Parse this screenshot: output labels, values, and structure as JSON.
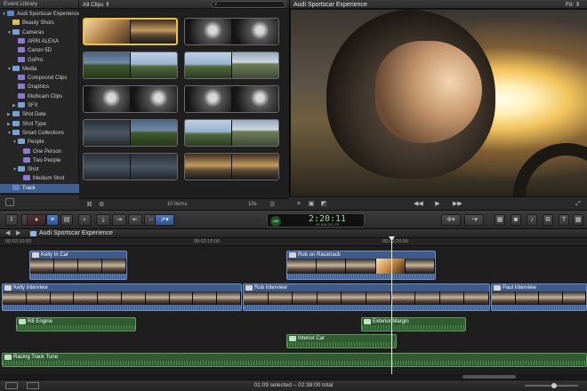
{
  "library": {
    "title": "Event Library",
    "items": [
      {
        "label": "Audi Sportscar Experience",
        "indent": 0,
        "tri": "▼",
        "icon": "event",
        "selected": false
      },
      {
        "label": "Beauty Shots",
        "indent": 1,
        "tri": "",
        "icon": "star",
        "selected": false
      },
      {
        "label": "Cameras",
        "indent": 1,
        "tri": "▼",
        "icon": "folder",
        "selected": false
      },
      {
        "label": "ARRI ALEXA",
        "indent": 2,
        "tri": "",
        "icon": "smart",
        "selected": false
      },
      {
        "label": "Canon 5D",
        "indent": 2,
        "tri": "",
        "icon": "smart",
        "selected": false
      },
      {
        "label": "GoPro",
        "indent": 2,
        "tri": "",
        "icon": "smart",
        "selected": false
      },
      {
        "label": "Media",
        "indent": 1,
        "tri": "▼",
        "icon": "folder",
        "selected": false
      },
      {
        "label": "Compound Clips",
        "indent": 2,
        "tri": "",
        "icon": "smart",
        "selected": false
      },
      {
        "label": "Graphics",
        "indent": 2,
        "tri": "",
        "icon": "smart",
        "selected": false
      },
      {
        "label": "Multicam Clips",
        "indent": 2,
        "tri": "",
        "icon": "smart",
        "selected": false
      },
      {
        "label": "SFX",
        "indent": 2,
        "tri": "▶",
        "icon": "folder",
        "selected": false
      },
      {
        "label": "Shot Date",
        "indent": 1,
        "tri": "▶",
        "icon": "folder",
        "selected": false
      },
      {
        "label": "Shot Type",
        "indent": 1,
        "tri": "▶",
        "icon": "folder",
        "selected": false
      },
      {
        "label": "Smart Collections",
        "indent": 1,
        "tri": "▼",
        "icon": "folder",
        "selected": false
      },
      {
        "label": "People",
        "indent": 2,
        "tri": "▼",
        "icon": "folder",
        "selected": false
      },
      {
        "label": "One Person",
        "indent": 3,
        "tri": "",
        "icon": "smart",
        "selected": false
      },
      {
        "label": "Two People",
        "indent": 3,
        "tri": "",
        "icon": "smart",
        "selected": false
      },
      {
        "label": "Shot",
        "indent": 2,
        "tri": "▼",
        "icon": "folder",
        "selected": false
      },
      {
        "label": "Medium Shot",
        "indent": 3,
        "tri": "",
        "icon": "smart",
        "selected": false
      },
      {
        "label": "Track",
        "indent": 1,
        "tri": "",
        "icon": "event",
        "selected": true
      }
    ]
  },
  "browser": {
    "filter": "All Clips ⇕",
    "search_icon": "search-icon",
    "items_count": "10 items",
    "zoom": "10s",
    "clips": [
      {
        "frames": [
          "f-warm",
          "f-sunset"
        ],
        "selected": true
      },
      {
        "frames": [
          "f-cockpit",
          "f-cockpit"
        ],
        "selected": false
      },
      {
        "frames": [
          "f-green",
          "f-sky"
        ],
        "selected": false
      },
      {
        "frames": [
          "f-sky",
          "f-car"
        ],
        "selected": false
      },
      {
        "frames": [
          "f-cockpit",
          "f-cockpit"
        ],
        "selected": false
      },
      {
        "frames": [
          "f-cockpit",
          "f-cockpit"
        ],
        "selected": false
      },
      {
        "frames": [
          "f-dark",
          "f-green"
        ],
        "selected": false
      },
      {
        "frames": [
          "f-sky",
          "f-car"
        ],
        "selected": false
      },
      {
        "frames": [
          "f-dark",
          "f-dark"
        ],
        "selected": false
      },
      {
        "frames": [
          "f-sunset",
          "f-sunset"
        ],
        "selected": false
      }
    ]
  },
  "viewer": {
    "title": "Audi Sportscar Experience",
    "fit": "Fit: ⇕"
  },
  "toolbar": {
    "timecode": "2:20:11",
    "timecode_percent": "100",
    "timecode_units": "HR  MIN  SEC  FR"
  },
  "timeline": {
    "project_title": "Audi Sportscar Experience",
    "ruler": [
      "00:02:10:00",
      "00:02:15:00",
      "00:02:20:00"
    ],
    "clips": {
      "kelly_in_car": "Kelly In Car",
      "rob_on_racetrack": "Rob on Racetrack",
      "kelly_interview": "Kelly Interview",
      "rob_interview": "Rob Interview",
      "paul_interview": "Paul Interview",
      "r8_engine": "R8 Engine",
      "exterior_margin": "Exterior Margin",
      "interior_car": "Interior Car",
      "racing_track_tune": "Racing Track Tune"
    }
  },
  "status": {
    "text": "01:09 selected – 02:38:00 total"
  },
  "colors": {
    "selection_blue": "#3f5e91",
    "highlight_yellow": "#f0c23a",
    "video_clip": "#3d5a8a",
    "audio_clip": "#2f5d31"
  }
}
